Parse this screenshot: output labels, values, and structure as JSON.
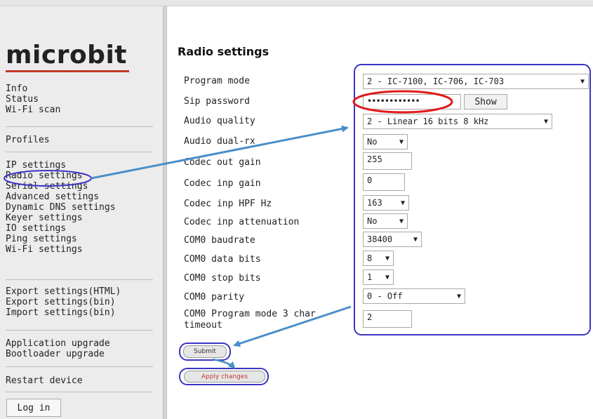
{
  "sidebar": {
    "logo": "microbit",
    "groups": [
      [
        "Info",
        "Status",
        "Wi-Fi scan"
      ],
      [
        "Profiles"
      ],
      [
        "IP settings",
        "Radio settings",
        "Serial settings",
        "Advanced settings",
        "Dynamic DNS settings",
        "Keyer settings",
        "IO settings",
        "Ping settings",
        "Wi-Fi settings"
      ],
      [
        "Export settings(HTML)",
        "Export settings(bin)",
        "Import settings(bin)"
      ],
      [
        "Application upgrade",
        "Bootloader upgrade"
      ],
      [
        "Restart device"
      ]
    ],
    "login_label": "Log in"
  },
  "main": {
    "title": "Radio settings",
    "fields": {
      "program_mode": {
        "label": "Program mode",
        "value": "2 - IC-7100, IC-706, IC-703"
      },
      "sip_password": {
        "label": "Sip password",
        "value": "••••••••••••",
        "show_label": "Show"
      },
      "audio_quality": {
        "label": "Audio quality",
        "value": "2 - Linear 16 bits 8 kHz"
      },
      "audio_dual_rx": {
        "label": "Audio dual-rx",
        "value": "No"
      },
      "codec_out_gain": {
        "label": "Codec out gain",
        "value": "255"
      },
      "codec_inp_gain": {
        "label": "Codec inp gain",
        "value": "0"
      },
      "codec_inp_hpf": {
        "label": "Codec inp HPF Hz",
        "value": "163"
      },
      "codec_inp_attenuation": {
        "label": "Codec inp attenuation",
        "value": "No"
      },
      "com0_baudrate": {
        "label": "COM0 baudrate",
        "value": "38400"
      },
      "com0_data_bits": {
        "label": "COM0 data bits",
        "value": "8"
      },
      "com0_stop_bits": {
        "label": "COM0 stop bits",
        "value": "1"
      },
      "com0_parity": {
        "label": "COM0 parity",
        "value": "0 - Off"
      },
      "com0_char_timeout": {
        "label_line1": "COM0 Program mode 3 char",
        "label_line2": "timeout",
        "value": "2"
      }
    },
    "submit_label": "Submit",
    "apply_label": "Apply changes"
  },
  "colors": {
    "sidebar_bg": "#ececec",
    "logo_underline": "#c0392b",
    "annotation_blue": "#4a8ec9",
    "annotation_purple": "#3b34c4",
    "annotation_red": "#e01b1b"
  },
  "icons": [
    "dropdown-caret-icon"
  ]
}
